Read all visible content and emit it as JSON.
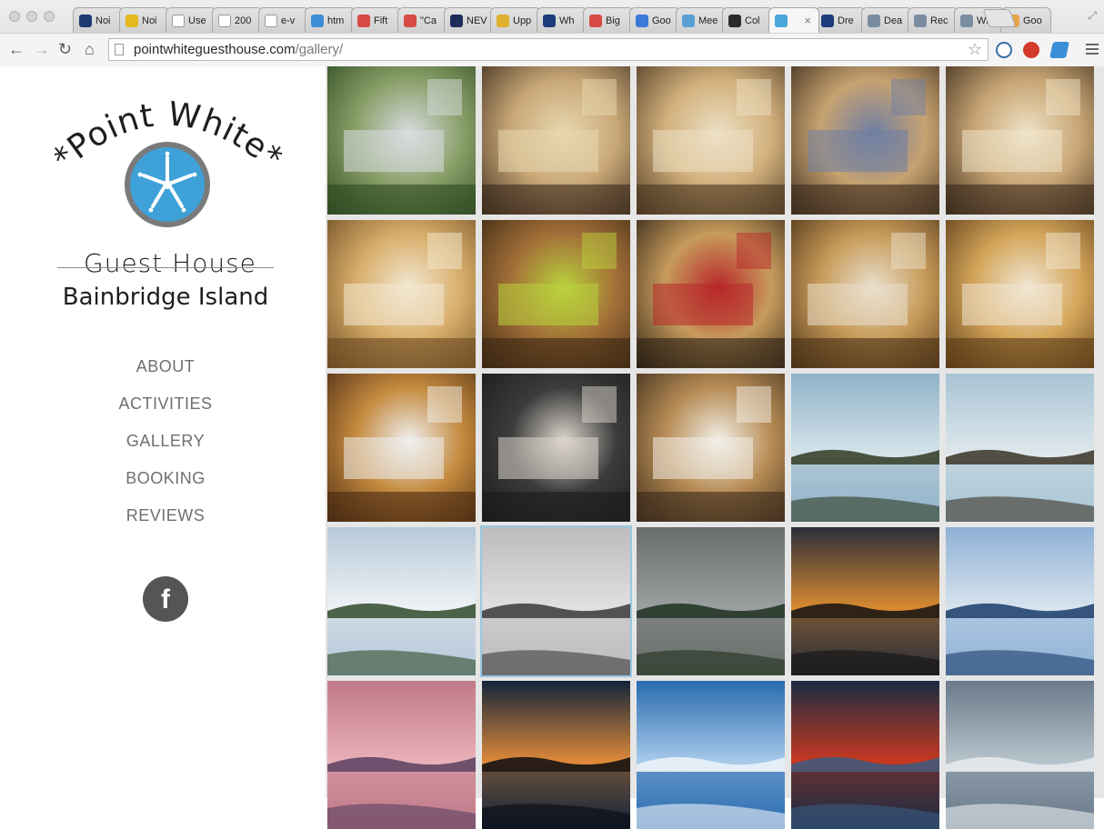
{
  "browser": {
    "tabs": [
      {
        "label": "Noi",
        "fav": "#1c3a6e"
      },
      {
        "label": "Noi",
        "fav": "#e5b820"
      },
      {
        "label": "Use",
        "fav": "#ffffff"
      },
      {
        "label": "200",
        "fav": "#ffffff"
      },
      {
        "label": "e-v",
        "fav": "#ffffff"
      },
      {
        "label": "htm",
        "fav": "#3b8ed6"
      },
      {
        "label": "Fift",
        "fav": "#d64b43"
      },
      {
        "label": "\"Ca",
        "fav": "#d64b43"
      },
      {
        "label": "NEV",
        "fav": "#1d2c5a"
      },
      {
        "label": "Upp",
        "fav": "#e0b030"
      },
      {
        "label": "Wh",
        "fav": "#1a3c7a"
      },
      {
        "label": "Big",
        "fav": "#d64b43"
      },
      {
        "label": "Goo",
        "fav": "#3c78d8"
      },
      {
        "label": "Mee",
        "fav": "#5a9fd4"
      },
      {
        "label": "Col",
        "fav": "#2a2a2a"
      },
      {
        "label": "",
        "fav": "#4aa6db",
        "active": true
      },
      {
        "label": "Dre",
        "fav": "#1a3c7a"
      },
      {
        "label": "Dea",
        "fav": "#7a8ca0"
      },
      {
        "label": "Rec",
        "fav": "#7a8ca0"
      },
      {
        "label": "Wh",
        "fav": "#7a8ca0"
      },
      {
        "label": "Goo",
        "fav": "#e8a54a"
      }
    ],
    "url_domain": "pointwhiteguesthouse.com",
    "url_path": "/gallery/",
    "close_glyph": "×"
  },
  "site": {
    "logo_line1": "*Point White*",
    "logo_line2": "Guest House",
    "subtitle": "Bainbridge Island",
    "nav": [
      "ABOUT",
      "ACTIVITIES",
      "GALLERY",
      "BOOKING",
      "REVIEWS"
    ],
    "facebook_glyph": "f"
  },
  "gallery": [
    {
      "scene": "house exterior with garden",
      "colors": [
        "#2d4a1f",
        "#8aa06a",
        "#d8dce0"
      ]
    },
    {
      "scene": "bunk room with wood cabinets",
      "colors": [
        "#3b2a1c",
        "#c9a877",
        "#e8d7b0"
      ]
    },
    {
      "scene": "bunk bed room",
      "colors": [
        "#4a3520",
        "#d2b07c",
        "#ece0c4"
      ]
    },
    {
      "scene": "bedroom with striped bedspread",
      "colors": [
        "#3a2a1c",
        "#c7a270",
        "#6f7fa4"
      ]
    },
    {
      "scene": "room with sofa and table",
      "colors": [
        "#3a2a1c",
        "#c8a574",
        "#efe3c8"
      ]
    },
    {
      "scene": "bed with stuffed bunny",
      "colors": [
        "#6b4a22",
        "#d8ad6a",
        "#f2e7d0"
      ]
    },
    {
      "scene": "basket and lime bowl",
      "colors": [
        "#3a2712",
        "#a36f38",
        "#b9d23c"
      ]
    },
    {
      "scene": "red coffee maker",
      "colors": [
        "#2c2014",
        "#c79b5c",
        "#b8282a"
      ]
    },
    {
      "scene": "dining table and chairs",
      "colors": [
        "#4a3015",
        "#c79a58",
        "#e9dfcc"
      ]
    },
    {
      "scene": "bunk bed corner",
      "colors": [
        "#5a3a16",
        "#d4a55a",
        "#f0e6d2"
      ]
    },
    {
      "scene": "bathroom with shower",
      "colors": [
        "#4a2a12",
        "#c48a3e",
        "#efefee"
      ]
    },
    {
      "scene": "vessel sink on dark counter",
      "colors": [
        "#1a1a1a",
        "#3b3b3b",
        "#dcd6cc"
      ]
    },
    {
      "scene": "bathroom with robe",
      "colors": [
        "#3a2a1a",
        "#b78c55",
        "#f2efe8"
      ]
    },
    {
      "scene": "chairs by fire pit at water",
      "colors": [
        "#8fb2c8",
        "#d6e4ea",
        "#2f3a22"
      ]
    },
    {
      "scene": "anchor by fire pit",
      "colors": [
        "#a8c4d4",
        "#dfe8ec",
        "#3a3226"
      ]
    },
    {
      "scene": "shoreline with trees",
      "colors": [
        "#b7c9d8",
        "#eef2f5",
        "#2f4a2a"
      ]
    },
    {
      "scene": "eagle over water",
      "colors": [
        "#bcbcbc",
        "#e0e0e0",
        "#3a3a3a"
      ]
    },
    {
      "scene": "rainbow with ferry",
      "colors": [
        "#6a6e6a",
        "#9aa0a0",
        "#1f3020"
      ]
    },
    {
      "scene": "sunset over water",
      "colors": [
        "#2a2e3a",
        "#d98a30",
        "#121212"
      ]
    },
    {
      "scene": "mountain and boat",
      "colors": [
        "#8eb0d6",
        "#d8e4ee",
        "#1a3c6a"
      ]
    },
    {
      "scene": "pink sunset",
      "colors": [
        "#c07a8a",
        "#e9b0b8",
        "#5a4060"
      ]
    },
    {
      "scene": "orange horizon sunset",
      "colors": [
        "#12243a",
        "#e08a3a",
        "#0a0a10"
      ]
    },
    {
      "scene": "ferry and mountain",
      "colors": [
        "#2a6bb0",
        "#a8cbea",
        "#eef4f8"
      ]
    },
    {
      "scene": "red buoy with seals",
      "colors": [
        "#1a2c44",
        "#c93820",
        "#3a5a80"
      ]
    },
    {
      "scene": "boat on frosty shore",
      "colors": [
        "#6a7a8a",
        "#b8c4cc",
        "#e8ecef"
      ]
    }
  ]
}
